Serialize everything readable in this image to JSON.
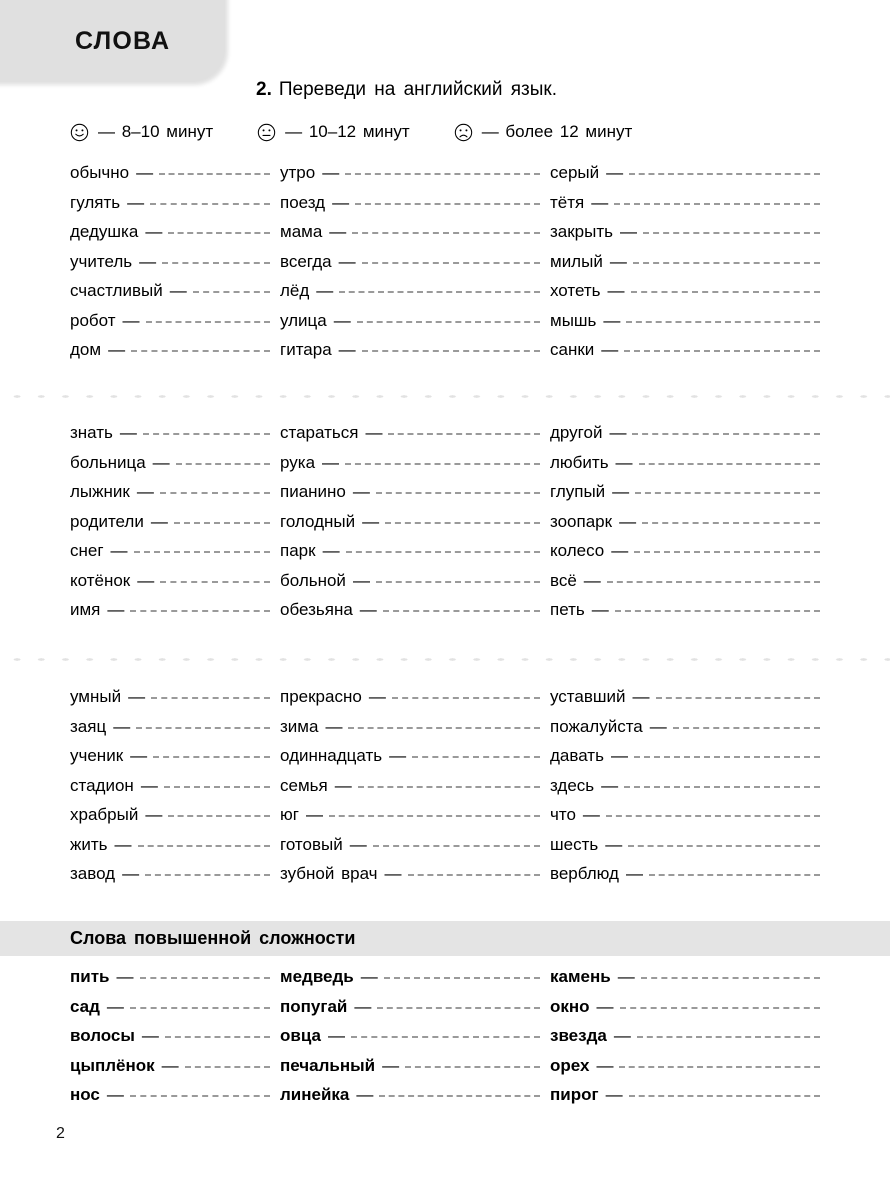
{
  "header": {
    "tab_title": "СЛОВА"
  },
  "task": {
    "number": "2.",
    "text": "Переведи на английский язык."
  },
  "legend": [
    {
      "icon": "smiley-happy-icon",
      "label": "— 8–10 минут"
    },
    {
      "icon": "smiley-neutral-icon",
      "label": "— 10–12 минут"
    },
    {
      "icon": "smiley-sad-icon",
      "label": "— более 12 минут"
    }
  ],
  "separator_dash": "—",
  "blocks": [
    {
      "columns": [
        [
          "обычно",
          "гулять",
          "дедушка",
          "учитель",
          "счастливый",
          "робот",
          "дом"
        ],
        [
          "утро",
          "поезд",
          "мама",
          "всегда",
          "лёд",
          "улица",
          "гитара"
        ],
        [
          "серый",
          "тётя",
          "закрыть",
          "милый",
          "хотеть",
          "мышь",
          "санки"
        ]
      ]
    },
    {
      "columns": [
        [
          "знать",
          "больница",
          "лыжник",
          "родители",
          "снег",
          "котёнок",
          "имя"
        ],
        [
          "стараться",
          "рука",
          "пианино",
          "голодный",
          "парк",
          "больной",
          "обезьяна"
        ],
        [
          "другой",
          "любить",
          "глупый",
          "зоопарк",
          "колесо",
          "всё",
          "петь"
        ]
      ]
    },
    {
      "columns": [
        [
          "умный",
          "заяц",
          "ученик",
          "стадион",
          "храбрый",
          "жить",
          "завод"
        ],
        [
          "прекрасно",
          "зима",
          "одиннадцать",
          "семья",
          "юг",
          "готовый",
          "зубной врач"
        ],
        [
          "уставший",
          "пожалуйста",
          "давать",
          "здесь",
          "что",
          "шесть",
          "верблюд"
        ]
      ]
    }
  ],
  "advanced": {
    "title": "Слова повышенной сложности",
    "columns": [
      [
        "пить",
        "сад",
        "волосы",
        "цыплёнок",
        "нос"
      ],
      [
        "медведь",
        "попугай",
        "овца",
        "печальный",
        "линейка"
      ],
      [
        "камень",
        "окно",
        "звезда",
        "орех",
        "пирог"
      ]
    ]
  },
  "footer": {
    "page_number": "2"
  },
  "colors": {
    "tab_bg": "#e0e0e0",
    "band_bg": "#e4e4e4",
    "dash_line": "#9a9a9a",
    "dot_sep": "#e2e2e2"
  }
}
